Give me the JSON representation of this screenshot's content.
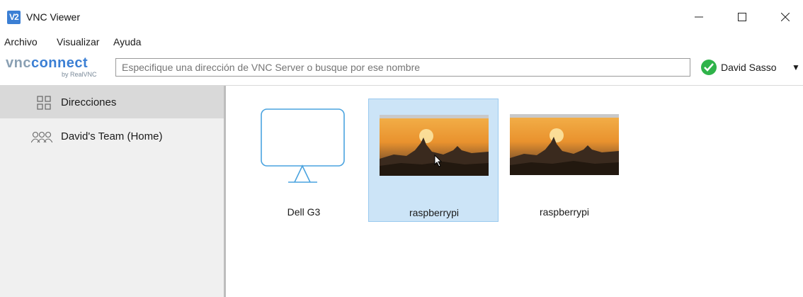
{
  "window": {
    "title": "VNC Viewer",
    "app_icon_text": "V2",
    "controls": {
      "minimize": "minimize-icon",
      "maximize": "maximize-icon",
      "close": "close-icon"
    }
  },
  "menu": {
    "items": [
      "Archivo",
      "Visualizar",
      "Ayuda"
    ]
  },
  "toolbar": {
    "logo_text_1": "vnc",
    "logo_text_2": "connect",
    "logo_sub": "by RealVNC",
    "search_placeholder": "Especifique una dirección de VNC Server o busque por ese nombre",
    "account_name": "David Sasso",
    "account_status_color": "#2fb34a",
    "account_caret": "▼"
  },
  "sidebar": {
    "items": [
      {
        "label": "Direcciones",
        "icon": "address-book-icon",
        "selected": true
      },
      {
        "label": "David's Team (Home)",
        "icon": "team-icon",
        "selected": false
      }
    ]
  },
  "connections": [
    {
      "name": "Dell G3",
      "thumbnail": "monitor-icon",
      "selected": false
    },
    {
      "name": "raspberrypi",
      "thumbnail": "desktop-screenshot",
      "selected": true
    },
    {
      "name": "raspberrypi",
      "thumbnail": "desktop-screenshot",
      "selected": false
    }
  ],
  "colors": {
    "accent": "#3b7fd4",
    "selection_bg": "#cce4f7",
    "sidebar_bg": "#f0f0f0",
    "sidebar_active": "#d9d9d9"
  }
}
